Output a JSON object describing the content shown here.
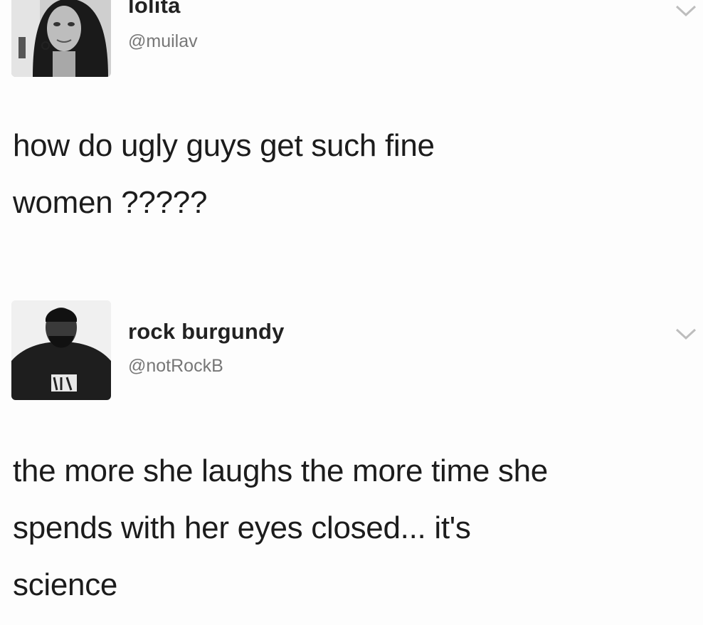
{
  "tweets": [
    {
      "display_name": "lolita",
      "handle": "@muilav",
      "lines": [
        "how do ugly guys get such fine",
        "women ?????"
      ],
      "avatar_icon": "profile-photo-woman"
    },
    {
      "display_name": "rock burgundy",
      "handle": "@notRockB",
      "lines": [
        "the more she laughs the more time she",
        "spends with her eyes closed...  it's",
        "science"
      ],
      "avatar_icon": "profile-photo-man"
    }
  ],
  "colors": {
    "background": "#fdfdfd",
    "name": "#222222",
    "handle": "#777777",
    "body_text": "#1c1c1c",
    "chevron": "#bdbdbd"
  }
}
